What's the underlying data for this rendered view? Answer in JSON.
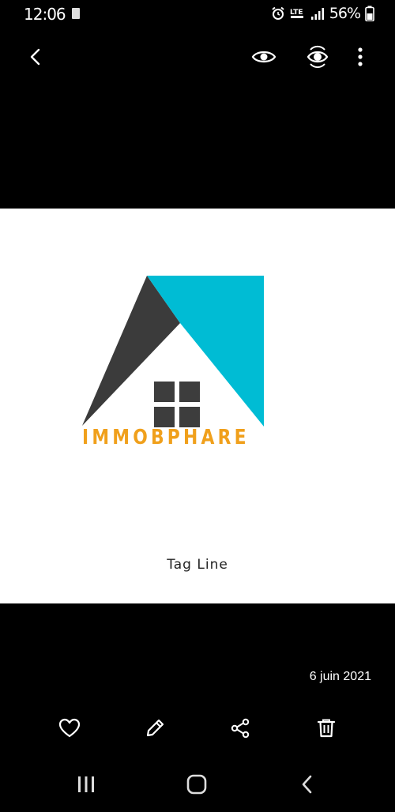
{
  "status_bar": {
    "time": "12:06",
    "battery_percent": "56%",
    "icons": [
      "sim-card-icon",
      "alarm-icon",
      "volte-icon",
      "signal-icon",
      "battery-icon"
    ]
  },
  "toolbar": {
    "back_icon": "back-arrow-icon",
    "view_icon": "eye-icon",
    "scan_icon": "eye-scan-icon",
    "more_icon": "more-vertical-icon"
  },
  "image": {
    "brand_name": "IMMOBPHARE",
    "tagline": "Tag Line",
    "colors": {
      "roof_dark": "#3b3b3b",
      "roof_cyan": "#00bcd4",
      "window": "#3d3d3d",
      "brand_text": "#f0a01c"
    }
  },
  "photo_info": {
    "date": "6 juin 2021"
  },
  "actions": {
    "favorite_icon": "heart-icon",
    "edit_icon": "pencil-icon",
    "share_icon": "share-icon",
    "delete_icon": "trash-icon"
  },
  "nav_bar": {
    "recents_icon": "recents-icon",
    "home_icon": "home-icon",
    "back_icon": "nav-back-icon"
  }
}
